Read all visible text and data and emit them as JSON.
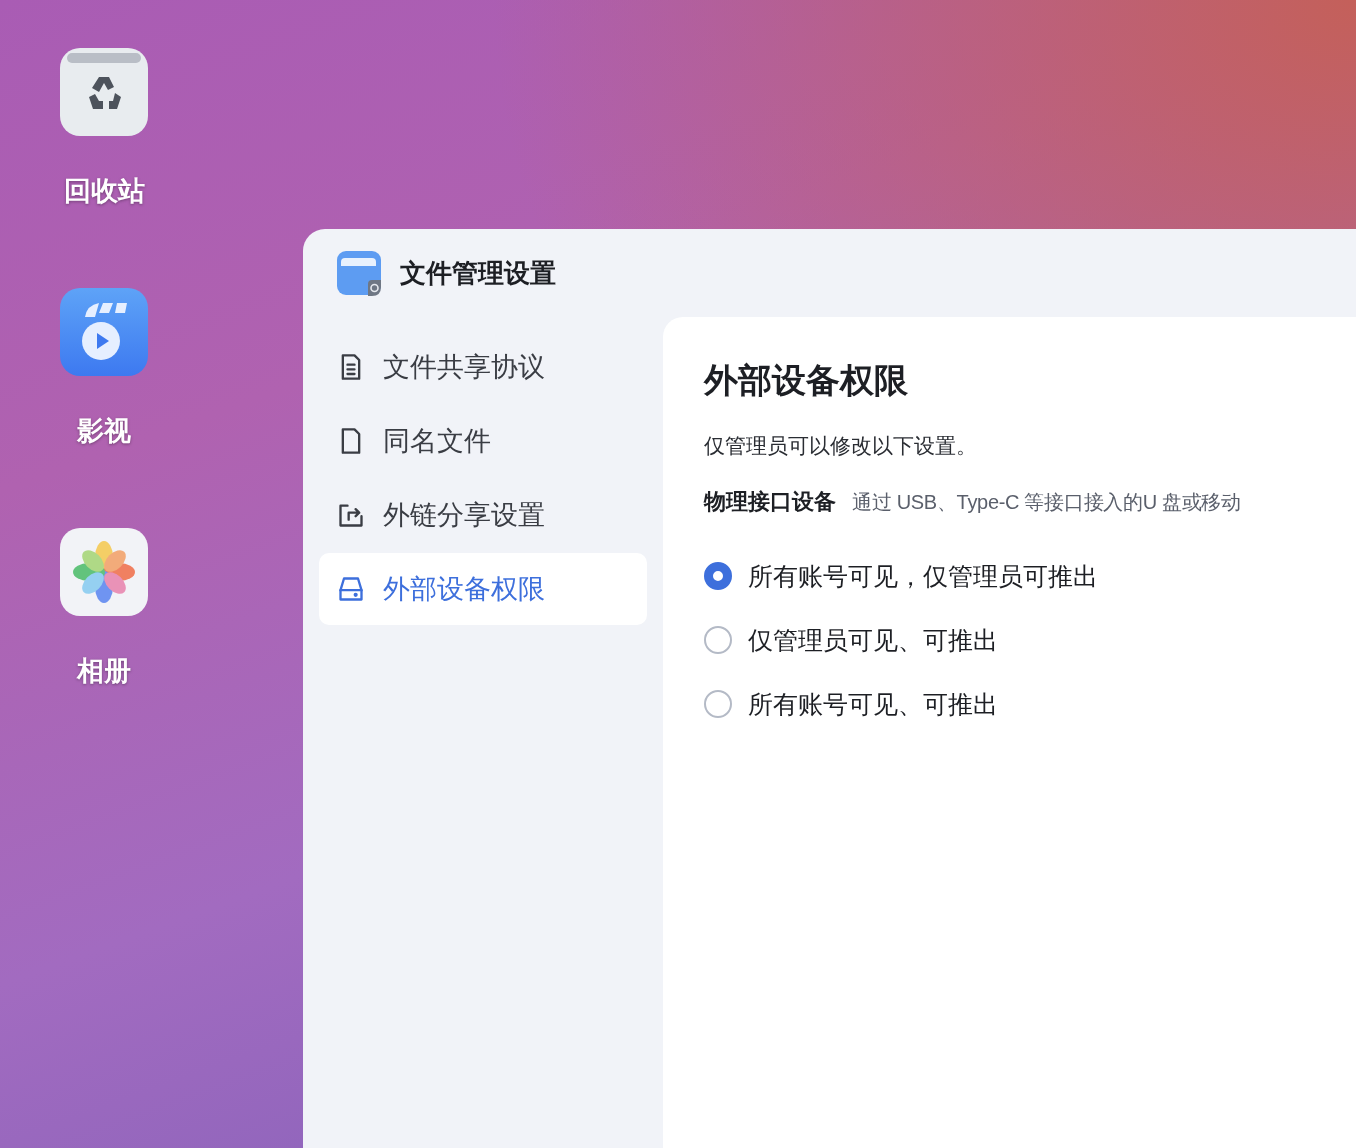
{
  "desktop": {
    "icons": [
      {
        "label": "回收站",
        "kind": "trash"
      },
      {
        "label": "影视",
        "kind": "video"
      },
      {
        "label": "相册",
        "kind": "photos"
      }
    ]
  },
  "window": {
    "title": "文件管理设置"
  },
  "sidebar": {
    "items": [
      {
        "label": "文件共享协议",
        "kind": "doc",
        "selected": false
      },
      {
        "label": "同名文件",
        "kind": "file",
        "selected": false
      },
      {
        "label": "外链分享设置",
        "kind": "share",
        "selected": false
      },
      {
        "label": "外部设备权限",
        "kind": "drive",
        "selected": true
      }
    ]
  },
  "content": {
    "heading": "外部设备权限",
    "note": "仅管理员可以修改以下设置。",
    "section_label": "物理接口设备",
    "section_description": "通过 USB、Type-C 等接口接入的U 盘或移动",
    "options": [
      {
        "label": "所有账号可见，仅管理员可推出",
        "selected": true
      },
      {
        "label": "仅管理员可见、可推出",
        "selected": false
      },
      {
        "label": "所有账号可见、可推出",
        "selected": false
      }
    ]
  }
}
